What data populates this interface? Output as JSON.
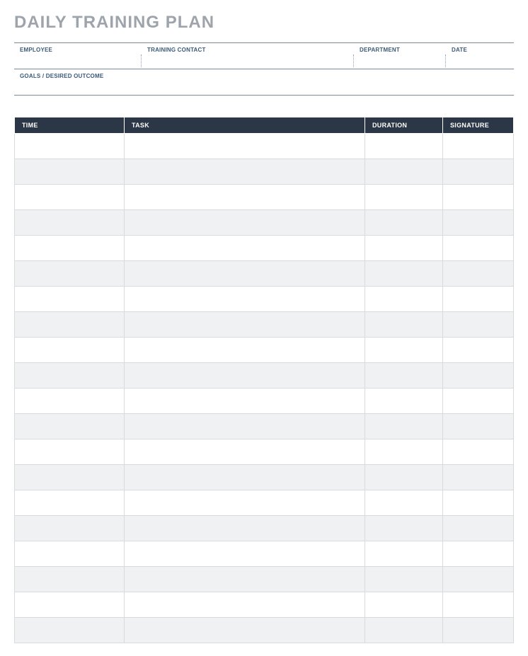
{
  "title": "DAILY TRAINING PLAN",
  "info": {
    "employee_label": "EMPLOYEE",
    "employee_value": "",
    "contact_label": "TRAINING CONTACT",
    "contact_value": "",
    "department_label": "DEPARTMENT",
    "department_value": "",
    "date_label": "DATE",
    "date_value": "",
    "goals_label": "GOALS / DESIRED OUTCOME",
    "goals_value": ""
  },
  "schedule": {
    "headers": {
      "time": "TIME",
      "task": "TASK",
      "duration": "DURATION",
      "signature": "SIGNATURE"
    },
    "rows": [
      {
        "time": "",
        "task": "",
        "duration": "",
        "signature": ""
      },
      {
        "time": "",
        "task": "",
        "duration": "",
        "signature": ""
      },
      {
        "time": "",
        "task": "",
        "duration": "",
        "signature": ""
      },
      {
        "time": "",
        "task": "",
        "duration": "",
        "signature": ""
      },
      {
        "time": "",
        "task": "",
        "duration": "",
        "signature": ""
      },
      {
        "time": "",
        "task": "",
        "duration": "",
        "signature": ""
      },
      {
        "time": "",
        "task": "",
        "duration": "",
        "signature": ""
      },
      {
        "time": "",
        "task": "",
        "duration": "",
        "signature": ""
      },
      {
        "time": "",
        "task": "",
        "duration": "",
        "signature": ""
      },
      {
        "time": "",
        "task": "",
        "duration": "",
        "signature": ""
      },
      {
        "time": "",
        "task": "",
        "duration": "",
        "signature": ""
      },
      {
        "time": "",
        "task": "",
        "duration": "",
        "signature": ""
      },
      {
        "time": "",
        "task": "",
        "duration": "",
        "signature": ""
      },
      {
        "time": "",
        "task": "",
        "duration": "",
        "signature": ""
      },
      {
        "time": "",
        "task": "",
        "duration": "",
        "signature": ""
      },
      {
        "time": "",
        "task": "",
        "duration": "",
        "signature": ""
      },
      {
        "time": "",
        "task": "",
        "duration": "",
        "signature": ""
      },
      {
        "time": "",
        "task": "",
        "duration": "",
        "signature": ""
      },
      {
        "time": "",
        "task": "",
        "duration": "",
        "signature": ""
      },
      {
        "time": "",
        "task": "",
        "duration": "",
        "signature": ""
      }
    ]
  }
}
